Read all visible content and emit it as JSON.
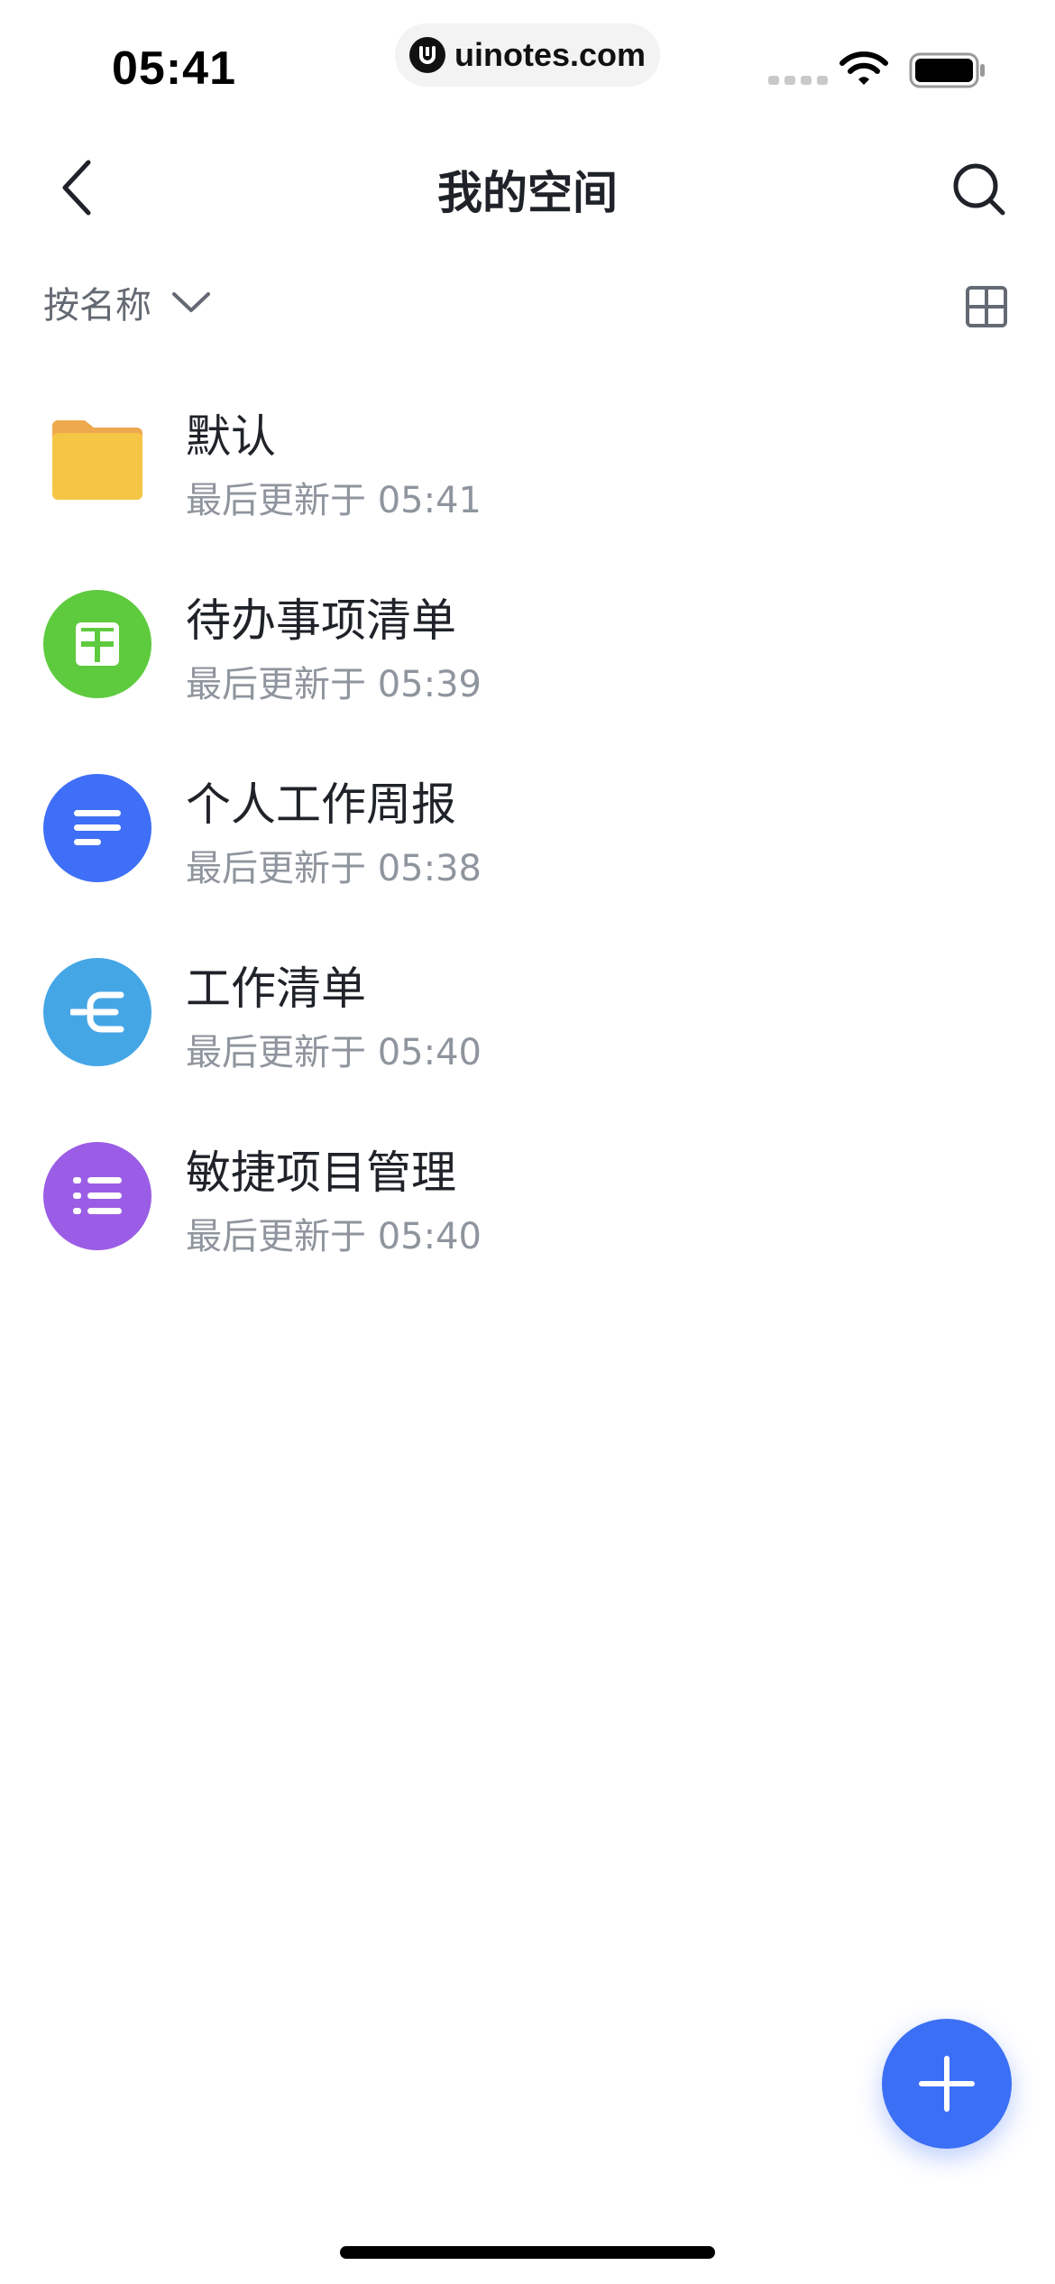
{
  "status_bar": {
    "time": "05:41",
    "watermark": "uinotes.com"
  },
  "nav": {
    "title": "我的空间"
  },
  "sort": {
    "label": "按名称"
  },
  "items": [
    {
      "title": "默认",
      "subtitle": "最后更新于 05:41",
      "icon": "folder-icon",
      "color": "#f5c545"
    },
    {
      "title": "待办事项清单",
      "subtitle": "最后更新于 05:39",
      "icon": "table-grid-icon",
      "color": "#5ecb3e"
    },
    {
      "title": "个人工作周报",
      "subtitle": "最后更新于 05:38",
      "icon": "document-lines-icon",
      "color": "#3f6ff6"
    },
    {
      "title": "工作清单",
      "subtitle": "最后更新于 05:40",
      "icon": "mindmap-icon",
      "color": "#45a6e6"
    },
    {
      "title": "敏捷项目管理",
      "subtitle": "最后更新于 05:40",
      "icon": "bullet-list-icon",
      "color": "#9b5de5"
    }
  ],
  "colors": {
    "accent": "#3b6ff5",
    "text_primary": "#1f2329",
    "text_secondary": "#8f959e"
  }
}
